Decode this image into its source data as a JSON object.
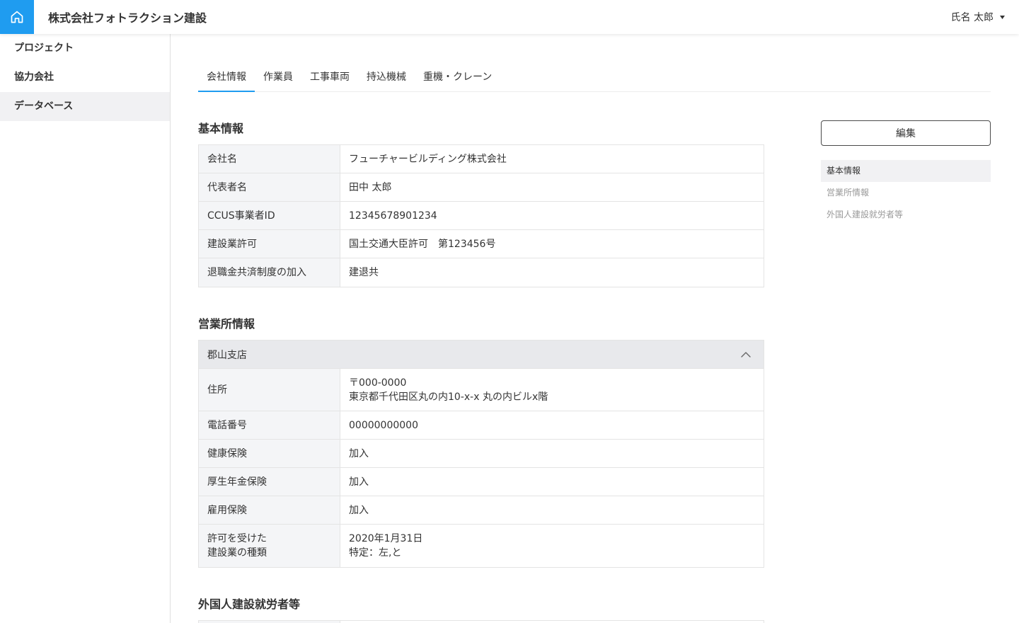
{
  "header": {
    "company_name": "株式会社フォトラクション建設",
    "user_name": "氏名 太郎",
    "home_icon": "home-icon",
    "user_menu_icon": "caret-down-icon"
  },
  "sidebar": {
    "items": [
      {
        "label": "プロジェクト",
        "active": false
      },
      {
        "label": "協力会社",
        "active": false
      },
      {
        "label": "データベース",
        "active": true
      }
    ]
  },
  "tabs": [
    {
      "label": "会社情報",
      "active": true
    },
    {
      "label": "作業員",
      "active": false
    },
    {
      "label": "工事車両",
      "active": false
    },
    {
      "label": "持込機械",
      "active": false
    },
    {
      "label": "重機・クレーン",
      "active": false
    }
  ],
  "basic_info": {
    "heading": "基本情報",
    "rows": [
      {
        "label": "会社名",
        "value": "フューチャービルディング株式会社"
      },
      {
        "label": "代表者名",
        "value": "田中 太郎"
      },
      {
        "label": "CCUS事業者ID",
        "value": "12345678901234"
      },
      {
        "label": "建設業許可",
        "value": "国土交通大臣許可　第123456号"
      },
      {
        "label": "退職金共済制度の加入",
        "value": "建退共"
      }
    ]
  },
  "offices": {
    "heading": "営業所情報",
    "items": [
      {
        "name": "郡山支店",
        "expanded": true,
        "toggle_icon": "chevron-up-icon",
        "rows": [
          {
            "label_lines": [
              "住所"
            ],
            "value_lines": [
              "〒000-0000",
              "東京都千代田区丸の内10-x-x 丸の内ビルx階"
            ]
          },
          {
            "label_lines": [
              "電話番号"
            ],
            "value_lines": [
              "00000000000"
            ]
          },
          {
            "label_lines": [
              "健康保険"
            ],
            "value_lines": [
              "加入"
            ]
          },
          {
            "label_lines": [
              "厚生年金保険"
            ],
            "value_lines": [
              "加入"
            ]
          },
          {
            "label_lines": [
              "雇用保険"
            ],
            "value_lines": [
              "加入"
            ]
          },
          {
            "label_lines": [
              "許可を受けた",
              "建設業の種類"
            ],
            "value_lines": [
              "2020年1月31日",
              "特定：左,と"
            ]
          }
        ]
      }
    ]
  },
  "foreign_workers": {
    "heading": "外国人建設就労者等"
  },
  "side_panel": {
    "edit_label": "編集",
    "anchors": [
      {
        "label": "基本情報",
        "active": true
      },
      {
        "label": "営業所情報",
        "active": false
      },
      {
        "label": "外国人建設就労者等",
        "active": false
      }
    ]
  },
  "colors": {
    "accent": "#1f9cf0",
    "text": "#333333",
    "label_bg": "#f4f5f7",
    "accordion_bg": "#e8e9ec",
    "active_bg": "#f1f1f3",
    "muted_text": "#9a9a9a",
    "border": "#e4e4e4"
  }
}
